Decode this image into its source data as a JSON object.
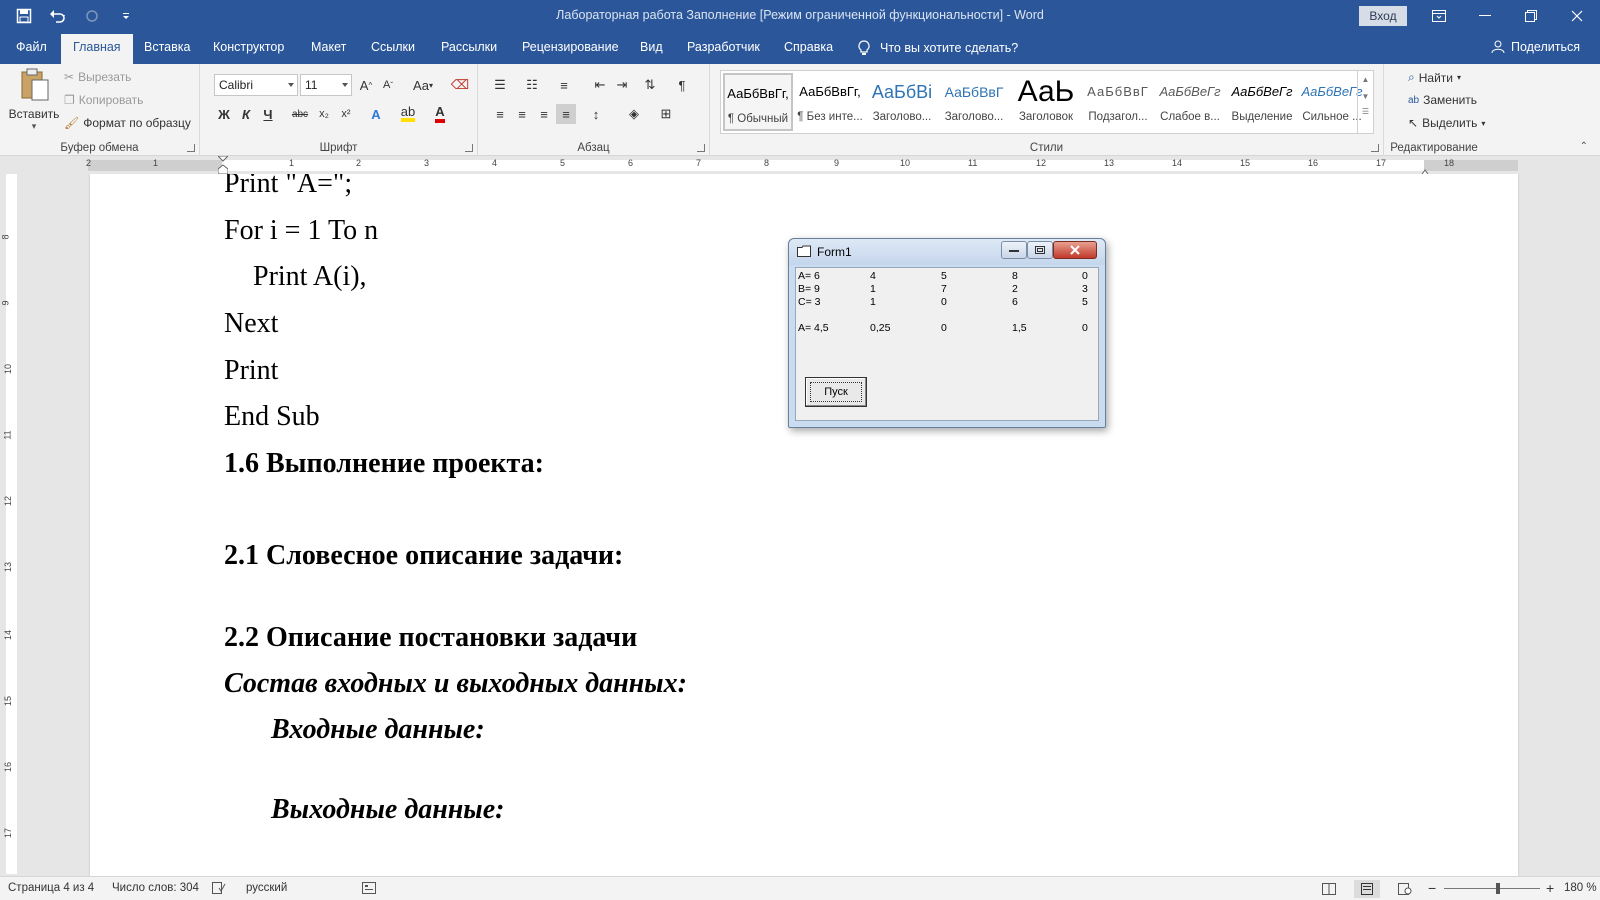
{
  "window": {
    "title": "Лабораторная работа Заполнение [Режим ограниченной функциональности]  -  Word",
    "signin_label": "Вход"
  },
  "tabs": [
    {
      "label": "Файл"
    },
    {
      "label": "Главная"
    },
    {
      "label": "Вставка"
    },
    {
      "label": "Конструктор"
    },
    {
      "label": "Макет"
    },
    {
      "label": "Ссылки"
    },
    {
      "label": "Рассылки"
    },
    {
      "label": "Рецензирование"
    },
    {
      "label": "Вид"
    },
    {
      "label": "Разработчик"
    },
    {
      "label": "Справка"
    }
  ],
  "active_tab": "Главная",
  "tell_me": "Что вы хотите сделать?",
  "share_label": "Поделиться",
  "ribbon": {
    "clipboard": {
      "paste": "Вставить",
      "cut": "Вырезать",
      "copy": "Копировать",
      "format_painter": "Формат по образцу",
      "label": "Буфер обмена"
    },
    "font": {
      "name": "Calibri",
      "size": "11",
      "label": "Шрифт",
      "bold": "Ж",
      "italic": "К",
      "underline": "Ч",
      "strike": "abc",
      "sub": "x₂",
      "sup": "x²",
      "case": "Aa"
    },
    "paragraph": {
      "label": "Абзац"
    },
    "styles": {
      "label": "Стили",
      "items": [
        {
          "preview": "АаБбВвГг,",
          "name": "¶ Обычный"
        },
        {
          "preview": "АаБбВвГг,",
          "name": "¶ Без инте..."
        },
        {
          "preview": "АаБбВі",
          "name": "Заголово..."
        },
        {
          "preview": "АаБбВвГ",
          "name": "Заголово..."
        },
        {
          "preview": "АаЬ",
          "name": "Заголовок"
        },
        {
          "preview": "АаБбВвГ",
          "name": "Подзагол..."
        },
        {
          "preview": "АаБбВеГг",
          "name": "Слабое в..."
        },
        {
          "preview": "АаБбВеГг",
          "name": "Выделение"
        },
        {
          "preview": "АаБбВеГг",
          "name": "Сильное ..."
        }
      ]
    },
    "editing": {
      "find": "Найти",
      "replace": "Заменить",
      "select": "Выделить",
      "label": "Редактирование"
    }
  },
  "ruler": {
    "h_numbers": [
      "2",
      "1",
      "1",
      "2",
      "3",
      "4",
      "5",
      "6",
      "7",
      "8",
      "9",
      "10",
      "11",
      "12",
      "13",
      "14",
      "15",
      "16",
      "17",
      "18"
    ],
    "v_numbers": [
      "8",
      "9",
      "10",
      "11",
      "12",
      "13",
      "14",
      "15",
      "16",
      "17"
    ]
  },
  "document": {
    "lines": [
      "Print \"A=\";",
      "For i = 1 To n",
      "Print A(i),",
      "Next",
      "Print",
      "End Sub",
      "1.6 Выполнение проекта:",
      "2.1 Словесное описание задачи:",
      "2.2  Описание постановки задачи",
      "Состав входных и выходных данных:",
      "Входные данные:",
      "Выходные данные:"
    ]
  },
  "form1": {
    "title": "Form1",
    "rows": [
      [
        "A= 6",
        "4",
        "5",
        "8",
        "0"
      ],
      [
        "B= 9",
        "1",
        "7",
        "2",
        "3"
      ],
      [
        "C= 3",
        "1",
        "0",
        "6",
        "5"
      ],
      [
        "A= 4,5",
        "0,25",
        "0",
        "1,5",
        "0"
      ]
    ],
    "button": "Пуск"
  },
  "status": {
    "page": "Страница 4 из 4",
    "words": "Число слов: 304",
    "language": "русский",
    "zoom": "180 %"
  },
  "colors": {
    "titlebar": "#2b579a",
    "ribbon": "#f3f3f3",
    "background": "#e6e6e6"
  }
}
